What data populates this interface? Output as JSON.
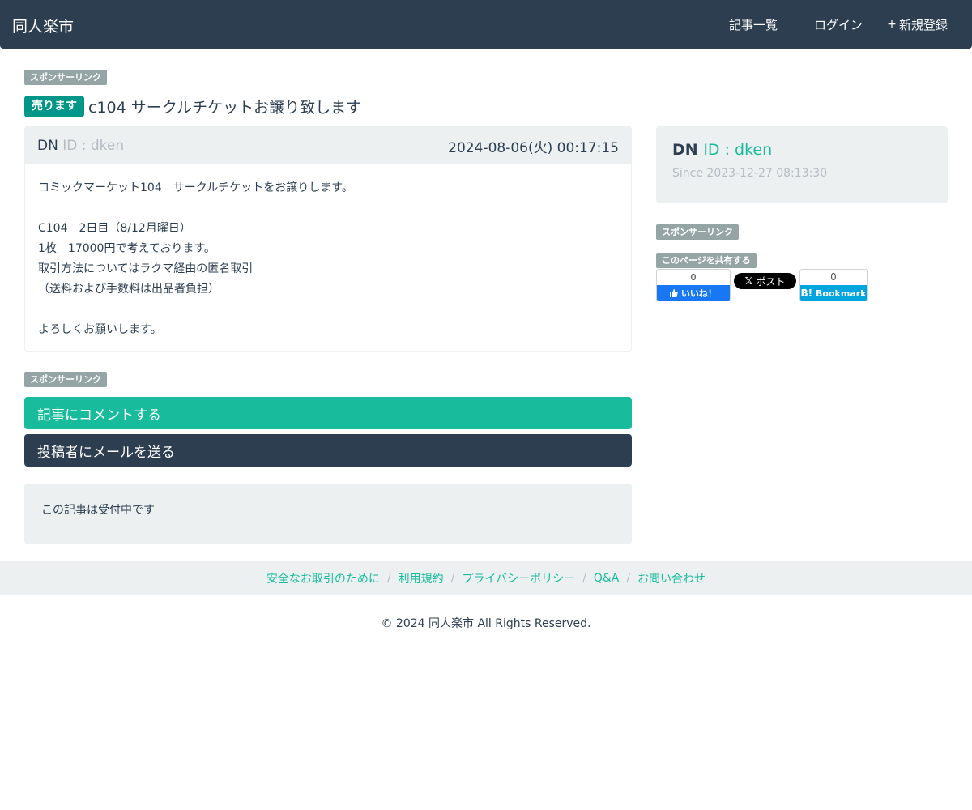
{
  "nav": {
    "brand": "同人楽市",
    "links": [
      {
        "icon": "",
        "label": "記事一覧"
      },
      {
        "icon": "",
        "label": "ログイン"
      },
      {
        "icon": "+",
        "label": "新規登録"
      }
    ]
  },
  "sponsor_label": "スポンサーリンク",
  "article": {
    "badge": "売ります",
    "title": "c104 サークルチケットお譲り致します",
    "user_icon": "",
    "user_name": "DN",
    "user_id": "ID : dken",
    "date_icon": "",
    "date": "2024-08-06(火) 00:17:15",
    "body": [
      "コミックマーケット104　サークルチケットをお譲りします。",
      "",
      "C104　2日目（8/12月曜日）",
      "1枚　17000円で考えております。",
      "取引方法についてはラクマ経由の匿名取引",
      "（送料および手数料は出品者負担）",
      "",
      "よろしくお願いします。"
    ]
  },
  "buttons": {
    "comment": "記事にコメントする",
    "mail": "投稿者にメールを送る"
  },
  "status": "この記事は受付中です",
  "profile": {
    "icon": "",
    "name": "DN",
    "id": "ID : dken",
    "since_icon": "",
    "since": "Since 2023-12-27 08:13:30"
  },
  "share": {
    "label": "このページを共有する",
    "facebook": {
      "count": "0",
      "label": "いいね！"
    },
    "x": {
      "label": "ポスト"
    },
    "hatena": {
      "count": "0",
      "label": "Bookmark"
    }
  },
  "footer": {
    "links": [
      "安全なお取引のために",
      "利用規約",
      "プライバシーポリシー",
      "Q&A",
      "お問い合わせ"
    ],
    "separator": "/",
    "copyright": "© 2024 同人楽市 All Rights Reserved."
  },
  "colors": {
    "navbar": "#2c3e50",
    "accent": "#18bc9c",
    "badge": "#009688",
    "muted": "#b4bcc2",
    "panel": "#ecf0f1"
  }
}
